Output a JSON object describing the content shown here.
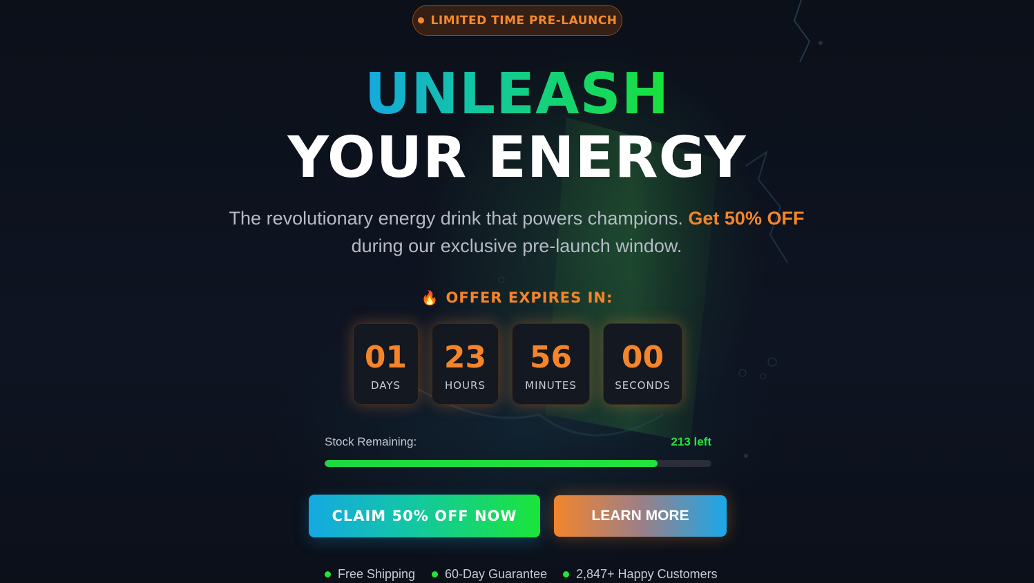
{
  "badge": {
    "label": "LIMITED TIME PRE-LAUNCH"
  },
  "hero": {
    "headline_1": "UNLEASH",
    "headline_2": "YOUR ENERGY",
    "subtitle_start": "The revolutionary energy drink that powers champions.",
    "subtitle_highlight": "Get 50% OFF",
    "subtitle_end": "during our exclusive pre-launch window."
  },
  "offer": {
    "label": "OFFER EXPIRES IN:",
    "icon": "fire-icon",
    "countdown": [
      {
        "value": "01",
        "unit": "DAYS"
      },
      {
        "value": "23",
        "unit": "HOURS"
      },
      {
        "value": "56",
        "unit": "MINUTES"
      },
      {
        "value": "00",
        "unit": "SECONDS"
      }
    ]
  },
  "stock": {
    "label": "Stock Remaining:",
    "left_text": "213 left",
    "fill_fraction": 0.86
  },
  "actions": {
    "claim_label": "CLAIM 50% OFF NOW",
    "learn_label": "LEARN MORE"
  },
  "perks": [
    "Free Shipping",
    "60-Day Guarantee",
    "2,847+ Happy Customers"
  ],
  "colors": {
    "accent_orange": "#f5852a",
    "accent_green": "#22e43a",
    "accent_blue": "#14a9e2",
    "background": "#0c111b"
  }
}
